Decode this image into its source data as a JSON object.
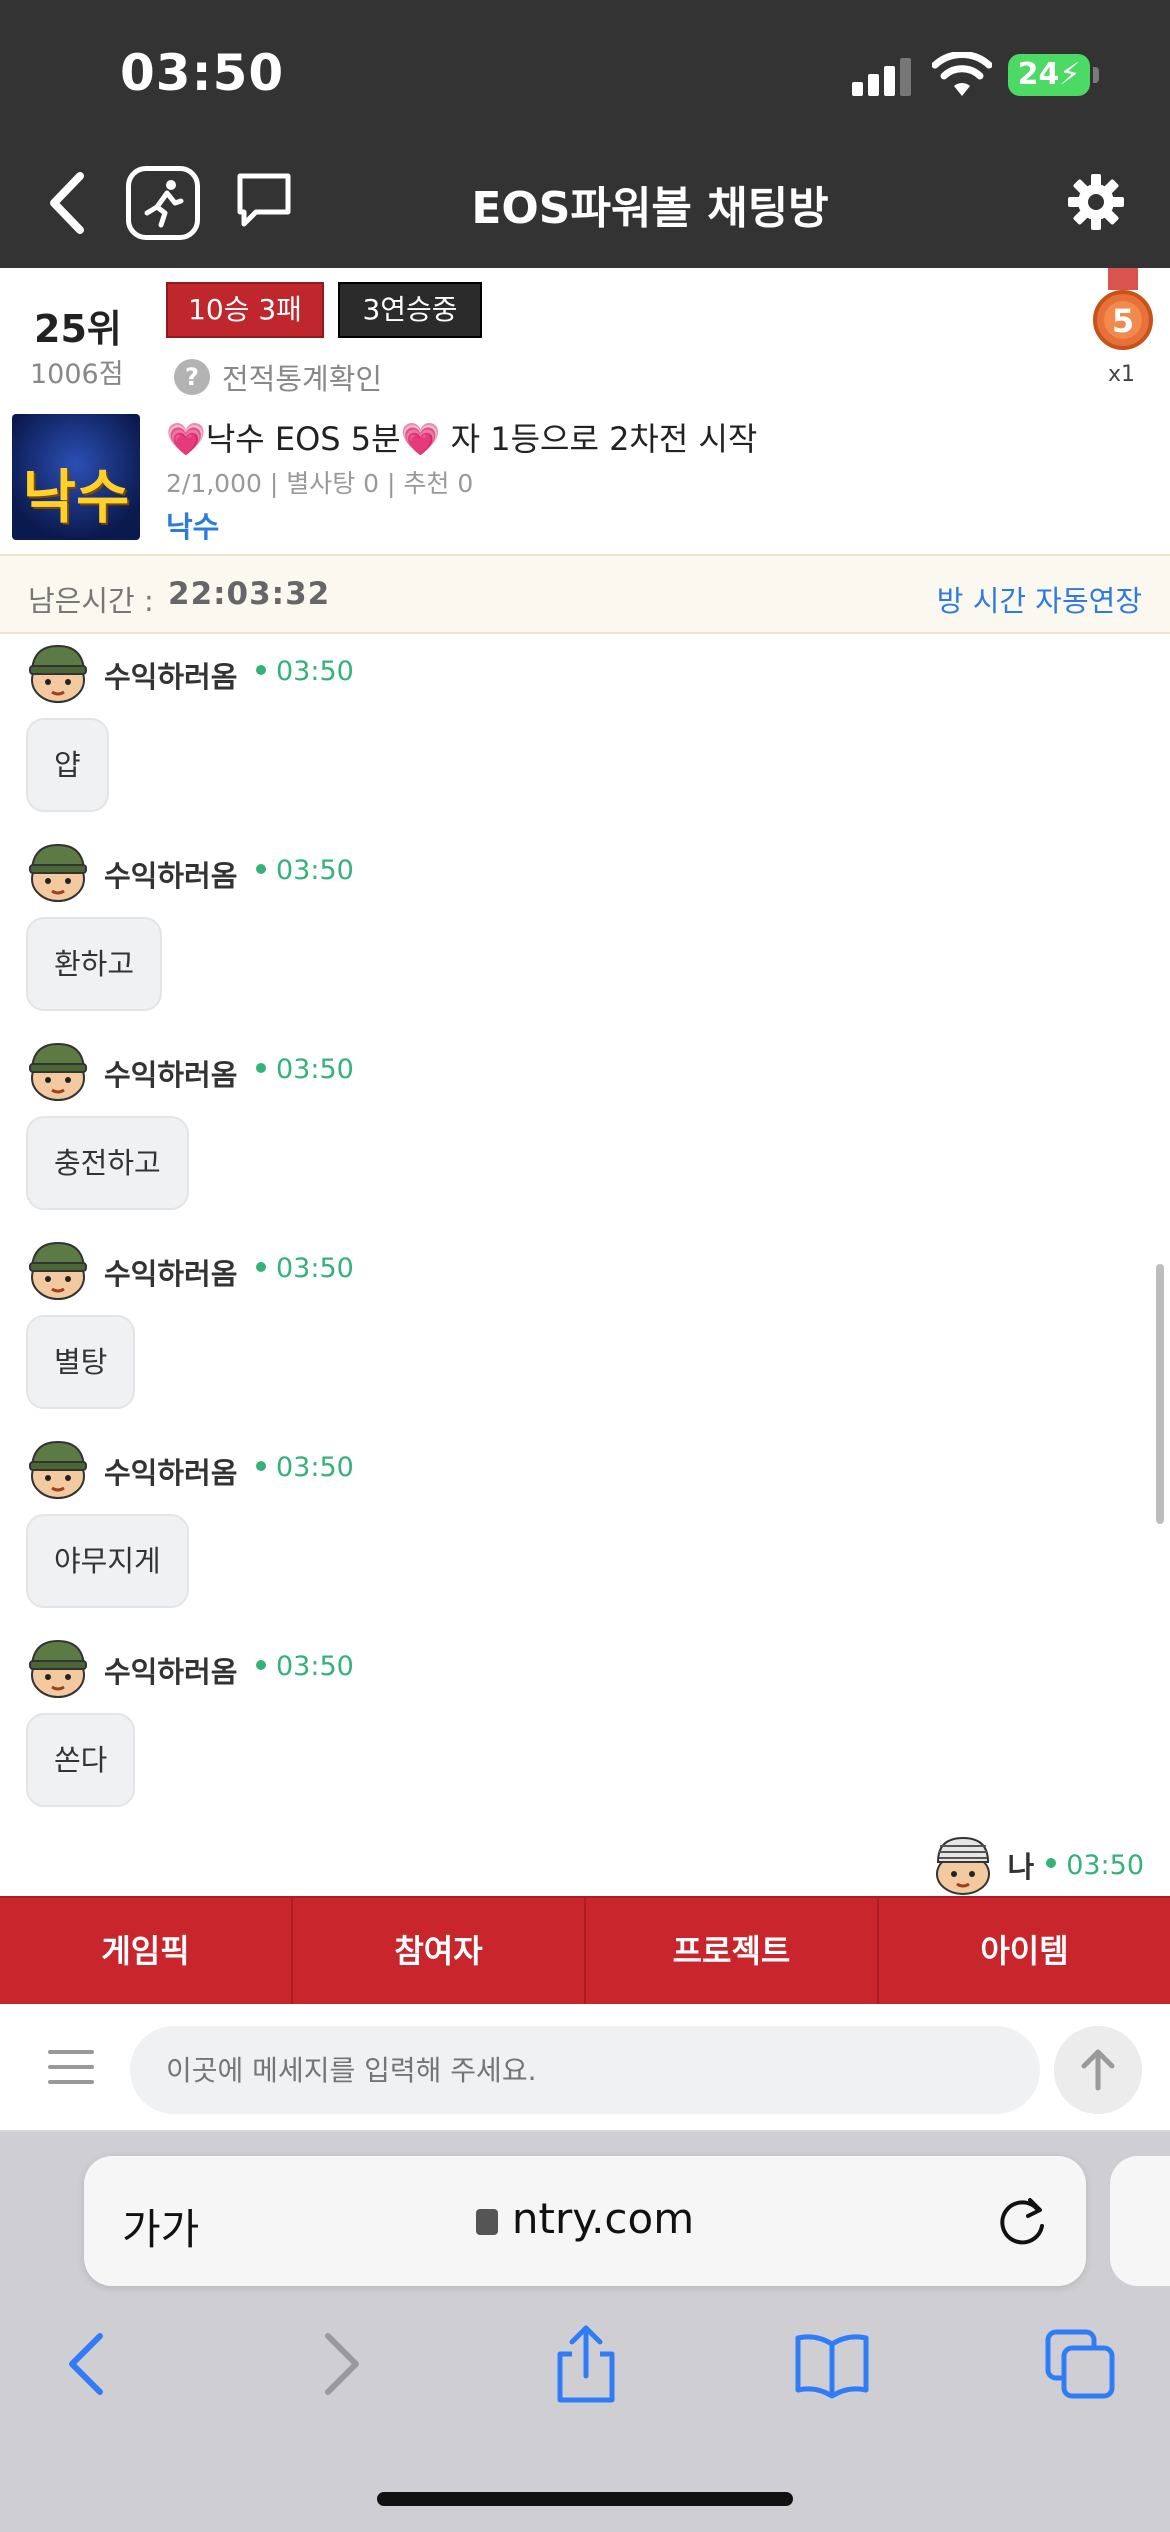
{
  "status_bar": {
    "time": "03:50",
    "battery": "24"
  },
  "header": {
    "title": "EOS파워볼 채팅방"
  },
  "room": {
    "rank": "25위",
    "points": "1006점",
    "record_badge": "10승 3패",
    "streak_badge": "3연승중",
    "stats_link": "전적통계확인",
    "medal_count": "x1",
    "thumb_text": "낙수",
    "title": "💗낙수 EOS 5분💗 자 1등으로 2차전 시작",
    "meta": "2/1,000 | 별사탕 0 | 추천 0",
    "owner": "낙수"
  },
  "timer": {
    "label": "남은시간 :",
    "value": "22:03:32",
    "extend_link": "방 시간 자동연장"
  },
  "messages": [
    {
      "user": "수익하러옴",
      "time": "03:50",
      "text": "얍"
    },
    {
      "user": "수익하러옴",
      "time": "03:50",
      "text": "환하고"
    },
    {
      "user": "수익하러옴",
      "time": "03:50",
      "text": "충전하고"
    },
    {
      "user": "수익하러옴",
      "time": "03:50",
      "text": "별탕"
    },
    {
      "user": "수익하러옴",
      "time": "03:50",
      "text": "야무지게"
    },
    {
      "user": "수익하러옴",
      "time": "03:50",
      "text": "쏜다"
    }
  ],
  "my_message": {
    "user": "나",
    "time": "03:50"
  },
  "tabs": [
    "게임픽",
    "참여자",
    "프로젝트",
    "아이템"
  ],
  "composer": {
    "placeholder": "이곳에 메세지를 입력해 주세요."
  },
  "browser": {
    "aa_label": "가가",
    "url": "ntry.com"
  },
  "colors": {
    "header_bg": "#333333",
    "tab_red": "#c9252c",
    "link_blue": "#2d7be0",
    "online_green": "#34b27a"
  }
}
